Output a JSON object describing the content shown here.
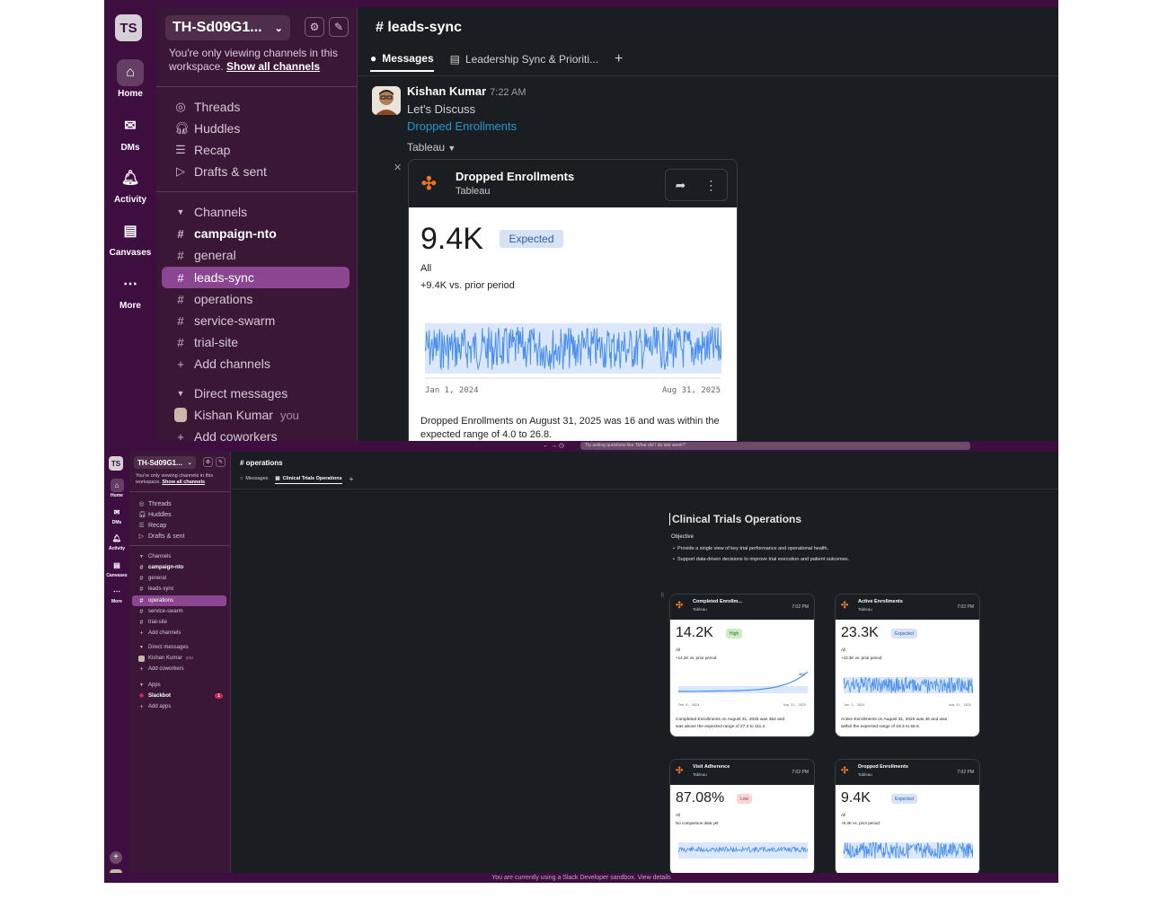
{
  "top": {
    "workspace": {
      "avatar": "TS",
      "name": "TH-Sd09G1...",
      "notice": "You're only viewing channels in this workspace.",
      "notice_link": "Show all channels"
    },
    "rail": [
      "Home",
      "DMs",
      "Activity",
      "Canvases",
      "More"
    ],
    "nav": [
      "Threads",
      "Huddles",
      "Recap",
      "Drafts & sent"
    ],
    "channels_label": "Channels",
    "channels": [
      "campaign-nto",
      "general",
      "leads-sync",
      "operations",
      "service-swarm",
      "trial-site"
    ],
    "add_channels": "Add channels",
    "dms_label": "Direct messages",
    "dm_user": "Kishan Kumar",
    "dm_you": "you",
    "add_coworkers": "Add coworkers",
    "channel_title": "# leads-sync",
    "tabs": [
      "Messages",
      "Leadership Sync & Prioriti..."
    ],
    "message": {
      "author": "Kishan Kumar",
      "time": "7:22 AM",
      "line1": "Let's Discuss",
      "link": "Dropped Enrollments",
      "app": "Tableau"
    },
    "card": {
      "title": "Dropped Enrollments",
      "source": "Tableau",
      "value": "9.4K",
      "badge": "Expected",
      "filter": "All",
      "delta": "+9.4K vs. prior period",
      "x_start": "Jan 1, 2024",
      "x_end": "Aug 31, 2025",
      "summary1": "Dropped Enrollments on August 31, 2025 was 16 and was within the",
      "summary2": "expected range of 4.0 to 26.8."
    }
  },
  "bottom": {
    "workspace": {
      "avatar": "TS",
      "name": "TH-Sd09G1...",
      "notice": "You're only viewing channels in this workspace.",
      "notice_link": "Show all channels"
    },
    "search_placeholder": "Try asking questions like 'What did I do last week?'",
    "rail": [
      "Home",
      "DMs",
      "Activity",
      "Canvases",
      "More"
    ],
    "nav": [
      "Threads",
      "Huddles",
      "Recap",
      "Drafts & sent"
    ],
    "channels_label": "Channels",
    "channels": [
      "campaign-nto",
      "general",
      "leads-sync",
      "operations",
      "service-swarm",
      "trial-site"
    ],
    "add_channels": "Add channels",
    "dms_label": "Direct messages",
    "dm_user": "Kishan Kumar",
    "dm_you": "you",
    "add_coworkers": "Add coworkers",
    "apps_label": "Apps",
    "app_slackbot": "Slackbot",
    "slackbot_badge": "1",
    "add_apps": "Add apps",
    "channel_title": "# operations",
    "tabs": [
      "Messages",
      "Clinical Trials Operations"
    ],
    "doc_title": "Clinical Trials Operations",
    "doc_objective": "Objective",
    "doc_bullets": [
      "Provide a single view of key trial performance and operational health.",
      "Support data-driven decisions to improve trial execution and patient outcomes."
    ],
    "cards": [
      {
        "title": "Completed Enrollm...",
        "source": "Tableau",
        "time": "7:02 PM",
        "value": "14.2K",
        "badge": "High",
        "badge_kind": "high",
        "filter": "All",
        "delta": "+14.2K vs. prior period",
        "x_start": "Feb 6, 2024",
        "x_end": "Aug 31, 2025",
        "peak": "362",
        "summary1": "Completed Enrollments on August 31, 2025 was 362 and",
        "summary2": "was above the expected range of 27.3 to 111.4."
      },
      {
        "title": "Active Enrollments",
        "source": "Tableau",
        "time": "7:02 PM",
        "value": "23.3K",
        "badge": "Expected",
        "badge_kind": "exp",
        "filter": "All",
        "delta": "+23.3K vs. prior period",
        "x_start": "Jan 1, 2024",
        "x_end": "Aug 31, 2025",
        "summary1": "Active Enrollments on August 31, 2025 was 46 and was",
        "summary2": "within the expected range of 19.3 to 56.6."
      },
      {
        "title": "Visit Adherence",
        "source": "Tableau",
        "time": "7:02 PM",
        "value": "87.08%",
        "badge": "Low",
        "badge_kind": "low",
        "filter": "All",
        "delta": "No comparison data yet"
      },
      {
        "title": "Dropped Enrollments",
        "source": "Tableau",
        "time": "7:02 PM",
        "value": "9.4K",
        "badge": "Expected",
        "badge_kind": "exp",
        "filter": "All",
        "delta": "+9.4K vs. prior period"
      }
    ],
    "footer": "You are currently using a Slack Developer sandbox. View details"
  },
  "colors": {
    "aubergine": "#3f0e40",
    "sidebar": "#3a1737",
    "selected": "#8c4591",
    "link": "#1d9bd1",
    "spark": "#4a8ff0"
  }
}
